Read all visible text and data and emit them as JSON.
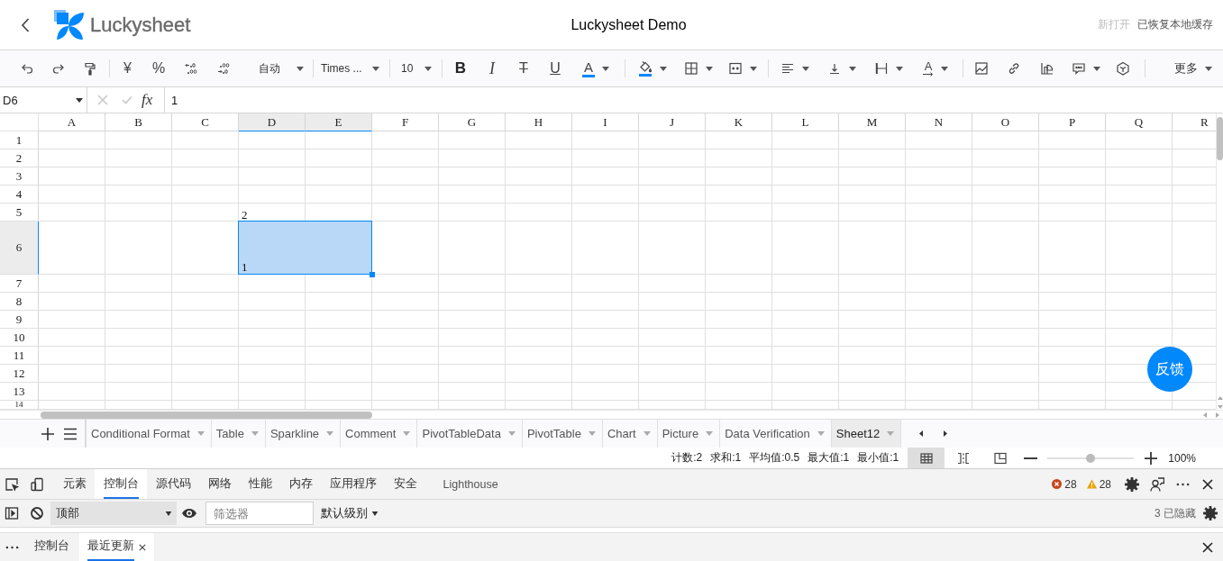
{
  "header": {
    "logo_text": "Luckysheet",
    "title": "Luckysheet Demo",
    "status": [
      {
        "text": "新打开",
        "muted": true
      },
      {
        "text": "已恢复本地缓存",
        "muted": false
      }
    ]
  },
  "toolbar": {
    "currency": "¥",
    "percent": "%",
    "number_format": "自动",
    "font": "Times ...",
    "font_size": "10",
    "bold": "B",
    "italic": "I",
    "strikethrough": "T",
    "underline": "U",
    "font_color": "A",
    "rotate": "A",
    "more": "更多"
  },
  "formula_bar": {
    "cell_ref": "D6",
    "fx": "fx",
    "value": "1"
  },
  "grid": {
    "columns": [
      {
        "label": "A",
        "selected": false
      },
      {
        "label": "B",
        "selected": false
      },
      {
        "label": "C",
        "selected": false
      },
      {
        "label": "D",
        "selected": true
      },
      {
        "label": "E",
        "selected": true
      },
      {
        "label": "F",
        "selected": false
      },
      {
        "label": "G",
        "selected": false
      },
      {
        "label": "H",
        "selected": false
      },
      {
        "label": "I",
        "selected": false
      },
      {
        "label": "J",
        "selected": false
      },
      {
        "label": "K",
        "selected": false
      },
      {
        "label": "L",
        "selected": false
      },
      {
        "label": "M",
        "selected": false
      },
      {
        "label": "N",
        "selected": false
      },
      {
        "label": "O",
        "selected": false
      },
      {
        "label": "P",
        "selected": false
      },
      {
        "label": "Q",
        "selected": false
      },
      {
        "label": "R",
        "selected": false
      }
    ],
    "rows": [
      {
        "label": "1",
        "selected": false
      },
      {
        "label": "2",
        "selected": false
      },
      {
        "label": "3",
        "selected": false
      },
      {
        "label": "4",
        "selected": false
      },
      {
        "label": "5",
        "selected": false,
        "cells": [
          null,
          null,
          null,
          {
            "value": "2",
            "selected": false,
            "merged": false
          }
        ]
      },
      {
        "label": "6",
        "selected": true,
        "cells": [
          null,
          null,
          null,
          {
            "value": "1",
            "selected": true,
            "merged": true
          }
        ]
      },
      {
        "label": "7",
        "selected": false
      },
      {
        "label": "8",
        "selected": false
      },
      {
        "label": "9",
        "selected": false
      },
      {
        "label": "10",
        "selected": false
      },
      {
        "label": "11",
        "selected": false
      },
      {
        "label": "12",
        "selected": false
      },
      {
        "label": "13",
        "selected": false
      },
      {
        "label": "14",
        "selected": false
      }
    ]
  },
  "feedback": "反馈",
  "sheets": [
    {
      "label": "Conditional Format",
      "selected": false
    },
    {
      "label": "Table",
      "selected": false
    },
    {
      "label": "Sparkline",
      "selected": false
    },
    {
      "label": "Comment",
      "selected": false
    },
    {
      "label": "PivotTableData",
      "selected": false
    },
    {
      "label": "PivotTable",
      "selected": false
    },
    {
      "label": "Chart",
      "selected": false
    },
    {
      "label": "Picture",
      "selected": false
    },
    {
      "label": "Data Verification",
      "selected": false
    },
    {
      "label": "Sheet12",
      "selected": true
    }
  ],
  "status": {
    "stats": [
      "计数:2",
      "求和:1",
      "平均值:0.5",
      "最大值:1",
      "最小值:1"
    ],
    "views": [
      {
        "kind": "normal",
        "selected": true
      },
      {
        "kind": "page_break",
        "selected": false
      },
      {
        "kind": "page_layout",
        "selected": false
      }
    ],
    "zoom": {
      "level": 0.5,
      "reading": "100%"
    }
  },
  "devtools": {
    "tabs": [
      {
        "label": "元素",
        "selected": false
      },
      {
        "label": "控制台",
        "selected": true
      },
      {
        "label": "源代码",
        "selected": false
      },
      {
        "label": "网络",
        "selected": false
      },
      {
        "label": "性能",
        "selected": false
      },
      {
        "label": "内存",
        "selected": false
      },
      {
        "label": "应用程序",
        "selected": false
      },
      {
        "label": "安全",
        "selected": false
      },
      {
        "label": "Lighthouse",
        "selected": false
      }
    ],
    "error_count": "28",
    "warning_count": "28",
    "context": "顶部",
    "filter_placeholder": "筛选器",
    "log_level": "默认级别",
    "hidden_count": "3 已隐藏",
    "drawer_tabs": [
      {
        "label": "控制台",
        "selected": false,
        "closable": false
      },
      {
        "label": "最近更新",
        "selected": true,
        "closable": true
      }
    ]
  }
}
